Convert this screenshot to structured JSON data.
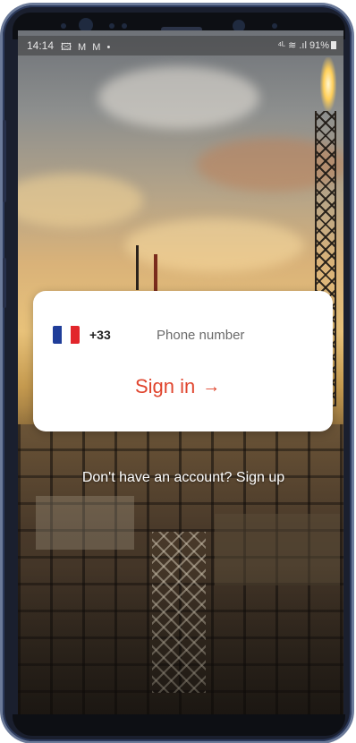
{
  "status_bar": {
    "time": "14:14",
    "notification_icons": "🖾 M M •",
    "signal_icons": "⁴ᴸ ≋ .ıl",
    "battery": "91%"
  },
  "login": {
    "country_code": "+33",
    "flag_colors": [
      "#1f3d99",
      "#ffffff",
      "#e2262b"
    ],
    "phone_placeholder": "Phone number",
    "signin_label": "Sign in",
    "signin_arrow": "→"
  },
  "footer": {
    "prompt": "Don't have an account?",
    "signup_label": "Sign up"
  },
  "colors": {
    "accent": "#e0452e"
  }
}
